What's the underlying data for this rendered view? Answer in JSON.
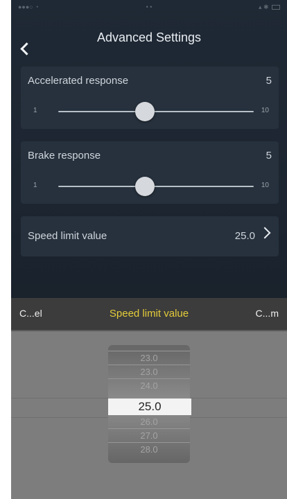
{
  "header": {
    "title": "Advanced Settings"
  },
  "accelerated": {
    "label": "Accelerated response",
    "value": "5",
    "min": "1",
    "max": "10",
    "level": 5
  },
  "brake": {
    "label": "Brake response",
    "value": "5",
    "min": "1",
    "max": "10",
    "level": 5
  },
  "speed_limit": {
    "label": "Speed limit value",
    "value": "25.0"
  },
  "picker": {
    "cancel_label": "C...el",
    "title": "Speed limit value",
    "confirm_label": "C...m",
    "options": [
      "23.0",
      "24.0",
      "25.0",
      "26.0",
      "27.0",
      "28.0"
    ],
    "selected": "25.0"
  },
  "colors": {
    "accent_title": "#e4cc3a",
    "card_bg": "#26313d"
  },
  "icons": {
    "back": "chevron-left-icon",
    "row": "chevron-right-icon",
    "slider": "slider-thumb"
  }
}
